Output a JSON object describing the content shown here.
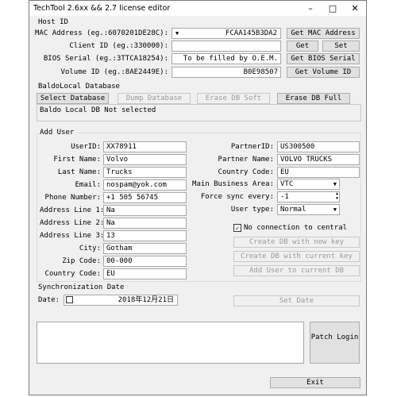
{
  "window": {
    "title": "TechTool 2.6xx && 2.7 license editor"
  },
  "host_id": {
    "section": "Host ID",
    "mac_label": "MAC Address (eg.:6070201DE28C):",
    "mac_value": "FCAA145B3DA2",
    "get_mac_button": "Get MAC Address",
    "client_label": "Client ID (eg.:330000):",
    "client_value": "",
    "get_button": "Get",
    "set_button": "Set",
    "bios_label": "BIOS Serial (eg.:3TTCA18254):",
    "bios_value": "To be filled by O.E.M.",
    "get_bios_button": "Get BIOS Serial",
    "volume_label": "Volume ID (eg.:8AE2449E):",
    "volume_value": "B0E98507",
    "get_volume_button": "Get Volume ID"
  },
  "baldo": {
    "section": "BaldoLocal Database",
    "select_button": "Select Database",
    "dump_button": "Dump Database",
    "erase_soft_button": "Erase DB Soft",
    "erase_full_button": "Erase DB Full",
    "status": "Baldo Local DB Not selected"
  },
  "add_user": {
    "section": "Add User",
    "userid_label": "UserID:",
    "userid_value": "XX78911",
    "firstname_label": "First Name:",
    "firstname_value": "Volvo",
    "lastname_label": "Last Name:",
    "lastname_value": "Trucks",
    "email_label": "Email:",
    "email_value": "nospam@yok.com",
    "phone_label": "Phone Number:",
    "phone_value": "+1 505 56745",
    "addr1_label": "Address Line 1:",
    "addr1_value": "Na",
    "addr2_label": "Address Line 2:",
    "addr2_value": "Na",
    "addr3_label": "Address Line 3:",
    "addr3_value": "13",
    "city_label": "City:",
    "city_value": "Gotham",
    "zip_label": "Zip Code:",
    "zip_value": "00-000",
    "country_label": "Country Code:",
    "country_value": "EU",
    "partnerid_label": "PartnerID:",
    "partnerid_value": "US300500",
    "partnername_label": "Partner Name:",
    "partnername_value": "VOLVO TRUCKS",
    "pcountry_label": "Country Code:",
    "pcountry_value": "EU",
    "mainarea_label": "Main Business Area:",
    "mainarea_value": "VTC",
    "forcesync_label": "Force sync every:",
    "forcesync_value": "-1",
    "usertype_label": "User type:",
    "usertype_value": "Normal",
    "noconn_label": "No connection to central",
    "create_new_key_button": "Create DB with new key",
    "create_current_key_button": "Create DB with current key",
    "add_user_current_button": "Add User to current DB"
  },
  "sync": {
    "section": "Synchronization Date",
    "date_label": "Date:",
    "date_value": "2018年12月21日",
    "set_date_button": "Set Date"
  },
  "patch_button": "Patch Login",
  "exit_button": "Exit"
}
